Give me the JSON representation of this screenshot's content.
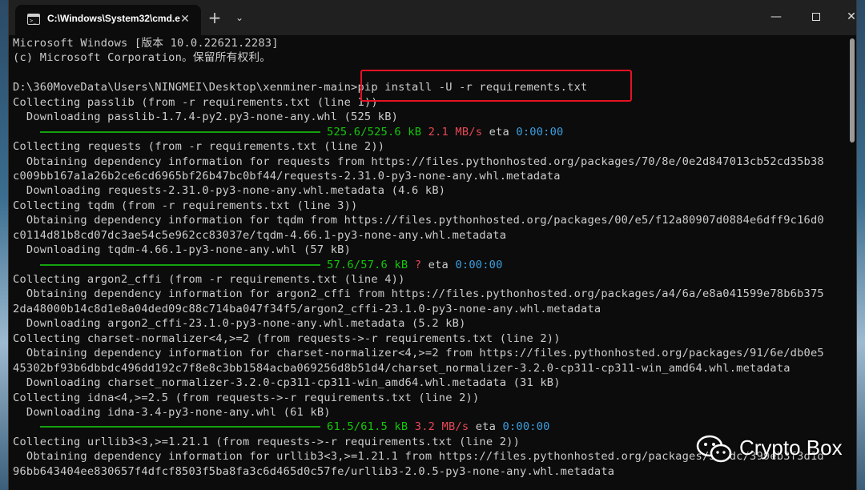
{
  "tab": {
    "title": "C:\\Windows\\System32\\cmd.e",
    "close": "✕",
    "icon_text": ">_"
  },
  "titlebar": {
    "new_tab": "+",
    "dropdown": "⌄",
    "minimize": "—",
    "close": "✕"
  },
  "terminal": {
    "lines": [
      {
        "type": "text",
        "text": "Microsoft Windows [版本 10.0.22621.2283]"
      },
      {
        "type": "text",
        "text": "(c) Microsoft Corporation。保留所有权利。"
      },
      {
        "type": "text",
        "text": ""
      },
      {
        "type": "text",
        "text": "D:\\360MoveData\\Users\\NINGMEI\\Desktop\\xenminer-main>pip install -U -r requirements.txt"
      },
      {
        "type": "text",
        "text": "Collecting passlib (from -r requirements.txt (line 1))"
      },
      {
        "type": "text",
        "text": "  Downloading passlib-1.7.4-py2.py3-none-any.whl (525 kB)"
      },
      {
        "type": "progress",
        "size": "525.6/525.6 kB",
        "speed": "2.1 MB/s",
        "eta_label": "eta",
        "eta": "0:00:00"
      },
      {
        "type": "text",
        "text": "Collecting requests (from -r requirements.txt (line 2))"
      },
      {
        "type": "text",
        "text": "  Obtaining dependency information for requests from https://files.pythonhosted.org/packages/70/8e/0e2d847013cb52cd35b38"
      },
      {
        "type": "text",
        "text": "c009bb167a1a26b2ce6cd6965bf26b47bc0bf44/requests-2.31.0-py3-none-any.whl.metadata"
      },
      {
        "type": "text",
        "text": "  Downloading requests-2.31.0-py3-none-any.whl.metadata (4.6 kB)"
      },
      {
        "type": "text",
        "text": "Collecting tqdm (from -r requirements.txt (line 3))"
      },
      {
        "type": "text",
        "text": "  Obtaining dependency information for tqdm from https://files.pythonhosted.org/packages/00/e5/f12a80907d0884e6dff9c16d0"
      },
      {
        "type": "text",
        "text": "c0114d81b8cd07dc3ae54c5e962cc83037e/tqdm-4.66.1-py3-none-any.whl.metadata"
      },
      {
        "type": "text",
        "text": "  Downloading tqdm-4.66.1-py3-none-any.whl (57 kB)"
      },
      {
        "type": "progress",
        "size": "57.6/57.6 kB",
        "speed": "?",
        "eta_label": "eta",
        "eta": "0:00:00"
      },
      {
        "type": "text",
        "text": "Collecting argon2_cffi (from -r requirements.txt (line 4))"
      },
      {
        "type": "text",
        "text": "  Obtaining dependency information for argon2_cffi from https://files.pythonhosted.org/packages/a4/6a/e8a041599e78b6b375"
      },
      {
        "type": "text",
        "text": "2da48000b14c8d1e8a04ded09c88c714ba047f34f5/argon2_cffi-23.1.0-py3-none-any.whl.metadata"
      },
      {
        "type": "text",
        "text": "  Downloading argon2_cffi-23.1.0-py3-none-any.whl.metadata (5.2 kB)"
      },
      {
        "type": "text",
        "text": "Collecting charset-normalizer<4,>=2 (from requests->-r requirements.txt (line 2))"
      },
      {
        "type": "text",
        "text": "  Obtaining dependency information for charset-normalizer<4,>=2 from https://files.pythonhosted.org/packages/91/6e/db0e5"
      },
      {
        "type": "text",
        "text": "45302bf93b6dbbdc496dd192c7f8e8c3bb1584acba069256d8b51d4/charset_normalizer-3.2.0-cp311-cp311-win_amd64.whl.metadata"
      },
      {
        "type": "text",
        "text": "  Downloading charset_normalizer-3.2.0-cp311-cp311-win_amd64.whl.metadata (31 kB)"
      },
      {
        "type": "text",
        "text": "Collecting idna<4,>=2.5 (from requests->-r requirements.txt (line 2))"
      },
      {
        "type": "text",
        "text": "  Downloading idna-3.4-py3-none-any.whl (61 kB)"
      },
      {
        "type": "progress",
        "size": "61.5/61.5 kB",
        "speed": "3.2 MB/s",
        "eta_label": "eta",
        "eta": "0:00:00"
      },
      {
        "type": "text",
        "text": "Collecting urllib3<3,>=1.21.1 (from requests->-r requirements.txt (line 2))"
      },
      {
        "type": "text",
        "text": "  Obtaining dependency information for urllib3<3,>=1.21.1 from https://files.pythonhosted.org/packages/37/dc/399eb3f3d1d"
      },
      {
        "type": "text",
        "text": "96bb643404ee830657f4dfcf8503f5ba8fa3c6d465d0c57fe/urllib3-2.0.5-py3-none-any.whl.metadata"
      }
    ]
  },
  "watermark": {
    "text": "Crypto Box"
  },
  "colors": {
    "progress_green": "#16c60c",
    "speed_red": "#e74856",
    "eta_blue": "#3b9fe0",
    "highlight_red": "#e81123"
  }
}
